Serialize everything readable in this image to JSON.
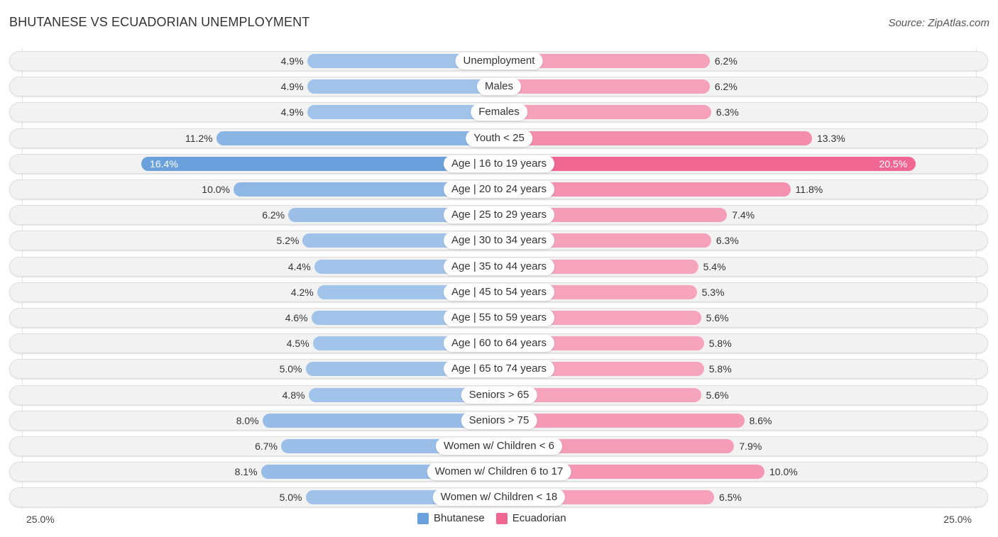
{
  "header": {
    "title": "BHUTANESE VS ECUADORIAN UNEMPLOYMENT",
    "source": "Source: ZipAtlas.com"
  },
  "colors": {
    "bhutanese": "#6aa1dc",
    "bhutanese_light": "#a4c4ea",
    "ecuadorian": "#f06892",
    "ecuadorian_light": "#f6a5bf"
  },
  "chart_data": {
    "type": "bar",
    "orientation": "horizontal-diverging",
    "title": "BHUTANESE VS ECUADORIAN UNEMPLOYMENT",
    "categories": [
      "Unemployment",
      "Males",
      "Females",
      "Youth < 25",
      "Age | 16 to 19 years",
      "Age | 20 to 24 years",
      "Age | 25 to 29 years",
      "Age | 30 to 34 years",
      "Age | 35 to 44 years",
      "Age | 45 to 54 years",
      "Age | 55 to 59 years",
      "Age | 60 to 64 years",
      "Age | 65 to 74 years",
      "Seniors > 65",
      "Seniors > 75",
      "Women w/ Children < 6",
      "Women w/ Children 6 to 17",
      "Women w/ Children < 18"
    ],
    "series": [
      {
        "name": "Bhutanese",
        "side": "left",
        "values": [
          4.9,
          4.9,
          4.9,
          11.2,
          16.4,
          10.0,
          6.2,
          5.2,
          4.4,
          4.2,
          4.6,
          4.5,
          5.0,
          4.8,
          8.0,
          6.7,
          8.1,
          5.0
        ],
        "labels": [
          "4.9%",
          "4.9%",
          "4.9%",
          "11.2%",
          "16.4%",
          "10.0%",
          "6.2%",
          "5.2%",
          "4.4%",
          "4.2%",
          "4.6%",
          "4.5%",
          "5.0%",
          "4.8%",
          "8.0%",
          "6.7%",
          "8.1%",
          "5.0%"
        ]
      },
      {
        "name": "Ecuadorian",
        "side": "right",
        "values": [
          6.2,
          6.2,
          6.3,
          13.3,
          20.5,
          11.8,
          7.4,
          6.3,
          5.4,
          5.3,
          5.6,
          5.8,
          5.8,
          5.6,
          8.6,
          7.9,
          10.0,
          6.5
        ],
        "labels": [
          "6.2%",
          "6.2%",
          "6.3%",
          "13.3%",
          "20.5%",
          "11.8%",
          "7.4%",
          "6.3%",
          "5.4%",
          "5.3%",
          "5.6%",
          "5.8%",
          "5.8%",
          "5.6%",
          "8.6%",
          "7.9%",
          "10.0%",
          "6.5%"
        ]
      }
    ],
    "axis": {
      "left_label": "25.0%",
      "right_label": "25.0%",
      "max": 25.0
    },
    "legend": {
      "position": "bottom-center",
      "items": [
        "Bhutanese",
        "Ecuadorian"
      ]
    },
    "highlighted_row": 4
  }
}
